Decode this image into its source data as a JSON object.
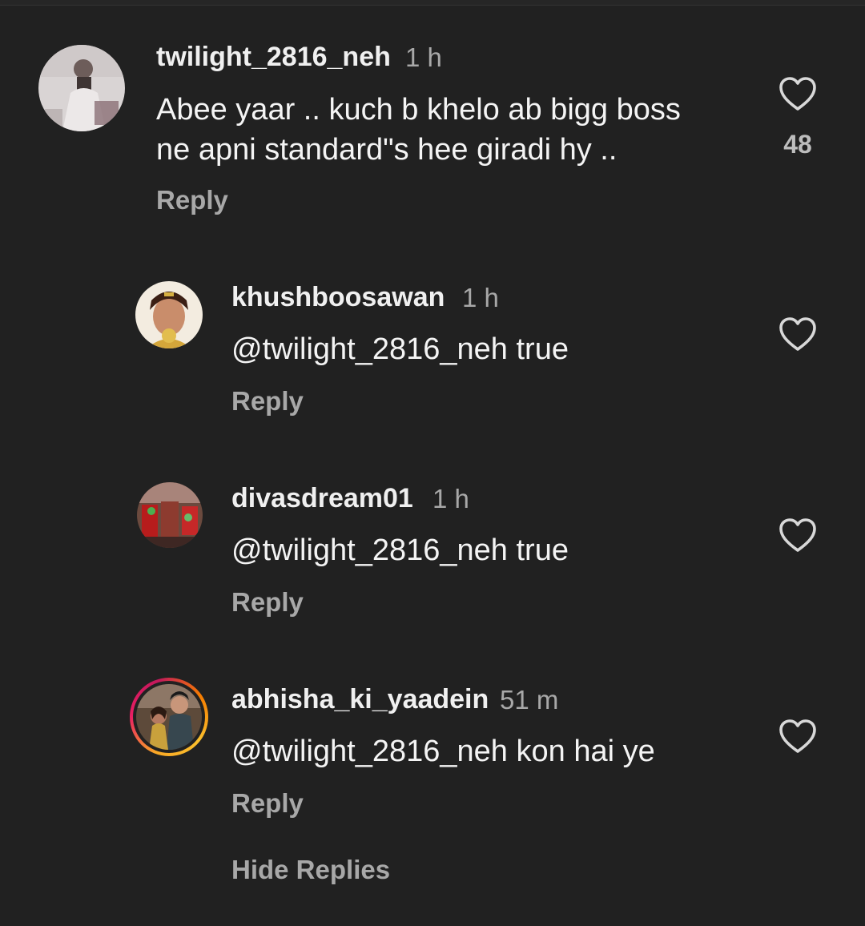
{
  "comments": [
    {
      "username": "twilight_2816_neh",
      "time": "1 h",
      "text_lines": [
        "Abee yaar .. kuch b khelo ab bigg boss",
        "ne apni standard\"s hee giradi hy .."
      ],
      "reply_label": "Reply",
      "like_count": "48",
      "avatar_icon": "avatar-photo-icon"
    },
    {
      "username": "khushboosawan",
      "time": "1 h",
      "text": "@twilight_2816_neh true",
      "reply_label": "Reply",
      "avatar_icon": "avatar-photo-icon"
    },
    {
      "username": "divasdream01",
      "time": "1 h",
      "text": "@twilight_2816_neh true",
      "reply_label": "Reply",
      "avatar_icon": "avatar-photo-icon"
    },
    {
      "username": "abhisha_ki_yaadein",
      "time": "51 m",
      "text": "@twilight_2816_neh kon hai ye",
      "reply_label": "Reply",
      "avatar_icon": "avatar-photo-icon",
      "story_ring": true
    }
  ],
  "hide_replies_label": "Hide Replies",
  "colors": {
    "background": "#212121",
    "primary_text": "#f4f4f4",
    "secondary_text": "#a8a8a8",
    "story_ring_start": "#f9a825",
    "story_ring_end": "#e91e63"
  }
}
